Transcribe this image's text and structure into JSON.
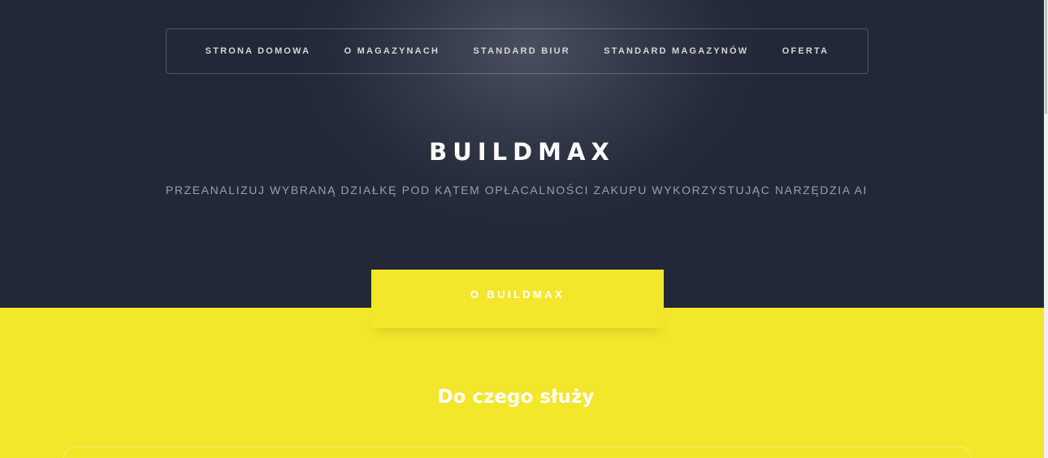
{
  "nav": {
    "items": [
      {
        "label": "STRONA DOMOWA"
      },
      {
        "label": "O MAGAZYNACH"
      },
      {
        "label": "STANDARD BIUR"
      },
      {
        "label": "STANDARD MAGAZYNÓW"
      },
      {
        "label": "OFERTA"
      }
    ]
  },
  "header": {
    "title": "BUILDMAX",
    "subtitle": "PRZEANALIZUJ WYBRANĄ DZIAŁKĘ POD KĄTEM OPŁACALNOŚCI ZAKUPU WYKORZYSTUJĄC NARZĘDZIA AI"
  },
  "section": {
    "tab_label": "O BUILDMAX",
    "heading": "Do czego służy"
  },
  "colors": {
    "hero_background": "#262b39",
    "accent_yellow": "#f4e62b",
    "text_white": "#ffffff",
    "subtitle_gray": "#9a9ea9"
  }
}
